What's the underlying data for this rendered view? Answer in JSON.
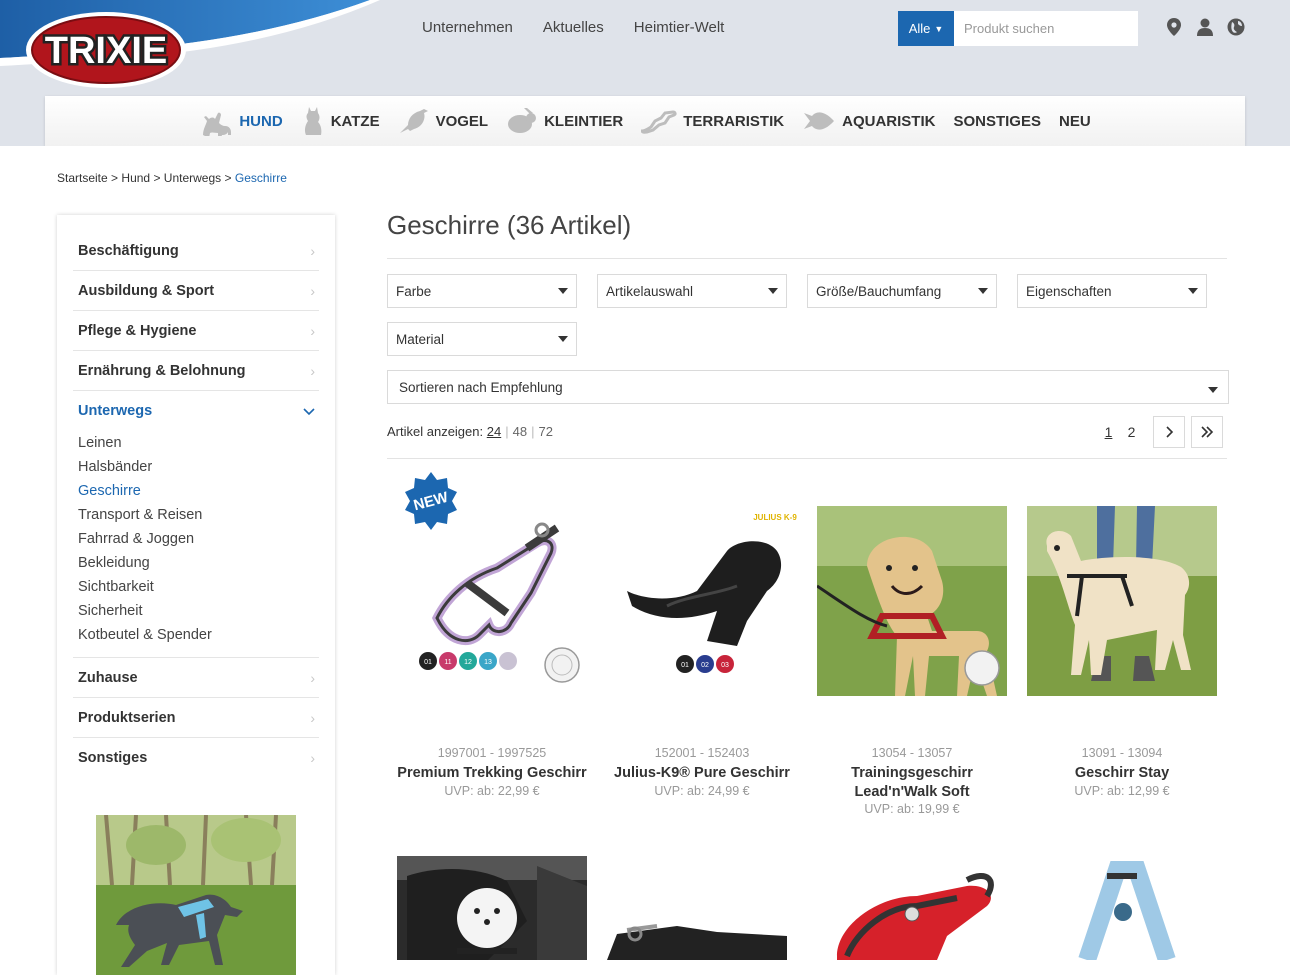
{
  "header": {
    "logo_text": "TRIXIE",
    "nav": [
      "Unternehmen",
      "Aktuelles",
      "Heimtier-Welt"
    ],
    "search": {
      "scope": "Alle",
      "placeholder": "Produkt suchen"
    },
    "icons": [
      "location-pin-icon",
      "user-icon",
      "globe-icon"
    ]
  },
  "categories": [
    {
      "label": "HUND",
      "icon": "dog-icon",
      "active": true
    },
    {
      "label": "KATZE",
      "icon": "cat-icon"
    },
    {
      "label": "VOGEL",
      "icon": "bird-icon"
    },
    {
      "label": "KLEINTIER",
      "icon": "rabbit-icon"
    },
    {
      "label": "TERRARISTIK",
      "icon": "lizard-icon"
    },
    {
      "label": "AQUARISTIK",
      "icon": "fish-icon"
    },
    {
      "label": "SONSTIGES"
    },
    {
      "label": "NEU"
    }
  ],
  "breadcrumb": {
    "items": [
      "Startseite",
      "Hund",
      "Unterwegs"
    ],
    "current": "Geschirre",
    "separator": ">"
  },
  "sidebar": {
    "items": [
      "Beschäftigung",
      "Ausbildung & Sport",
      "Pflege & Hygiene",
      "Ernährung & Belohnung",
      "Unterwegs",
      "Zuhause",
      "Produktserien",
      "Sonstiges"
    ],
    "open_item": "Unterwegs",
    "sub_items": [
      "Leinen",
      "Halsbänder",
      "Geschirre",
      "Transport & Reisen",
      "Fahrrad & Joggen",
      "Bekleidung",
      "Sichtbarkeit",
      "Sicherheit",
      "Kotbeutel & Spender"
    ],
    "active_sub": "Geschirre"
  },
  "main": {
    "title": "Geschirre (36 Artikel)",
    "filters": [
      "Farbe",
      "Artikelauswahl",
      "Größe/Bauchumfang",
      "Eigenschaften",
      "Material"
    ],
    "sort": "Sortieren nach Empfehlung",
    "per_page_label": "Artikel anzeigen:",
    "per_page": [
      "24",
      "48",
      "72"
    ],
    "pages": [
      "1",
      "2"
    ],
    "current_page": "1"
  },
  "products": [
    {
      "number": "1997001 - 1997525",
      "name": "Premium Trekking Geschirr",
      "price": "UVP: ab: 22,99 €",
      "badge": "NEW",
      "colors": [
        "01",
        "11",
        "12",
        "13"
      ]
    },
    {
      "number": "152001 - 152403",
      "name": "Julius-K9® Pure Geschirr",
      "price": "UVP: ab: 24,99 €",
      "brand_mark": "JULIUS K-9",
      "colors": [
        "01",
        "02",
        "03"
      ]
    },
    {
      "number": "13054 - 13057",
      "name": "Trainingsgeschirr Lead'n'Walk Soft",
      "price": "UVP: ab: 19,99 €"
    },
    {
      "number": "13091 - 13094",
      "name": "Geschirr Stay",
      "price": "UVP: ab: 12,99 €"
    }
  ],
  "colors": {
    "brand_blue": "#1c67b0",
    "logo_red": "#b1151c",
    "header_bg": "#dfe3ea"
  }
}
